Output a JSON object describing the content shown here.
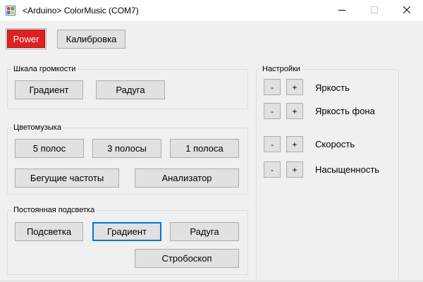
{
  "window": {
    "title": "<Arduino> ColorMusic (COM7)",
    "icons": {
      "app": "app-icon",
      "minimize": "minimize-icon",
      "maximize": "maximize-icon",
      "close": "close-icon"
    }
  },
  "toolbar": {
    "power_label": "Power",
    "calibration_label": "Калибровка"
  },
  "volume_scale": {
    "title": "Шкала громкости",
    "gradient_label": "Градиент",
    "rainbow_label": "Радуга"
  },
  "color_music": {
    "title": "Цветомузыка",
    "five_bands_label": "5 полос",
    "three_bands_label": "3 полосы",
    "one_band_label": "1 полоса",
    "running_freq_label": "Бегущие частоты",
    "analyzer_label": "Анализатор"
  },
  "constant_light": {
    "title": "Постоянная подсветка",
    "backlight_label": "Подсветка",
    "gradient_label": "Градиент",
    "rainbow_label": "Радуга",
    "strobe_label": "Стробоскоп"
  },
  "settings": {
    "title": "Настройки",
    "minus_label": "-",
    "plus_label": "+",
    "brightness_label": "Яркость",
    "bg_brightness_label": "Яркость фона",
    "speed_label": "Скорость",
    "saturation_label": "Насыщенность"
  },
  "colors": {
    "power_bg": "#e02020",
    "focus_border": "#0078d7",
    "window_bg": "#f0f0f0",
    "button_bg": "#e1e1e1"
  }
}
